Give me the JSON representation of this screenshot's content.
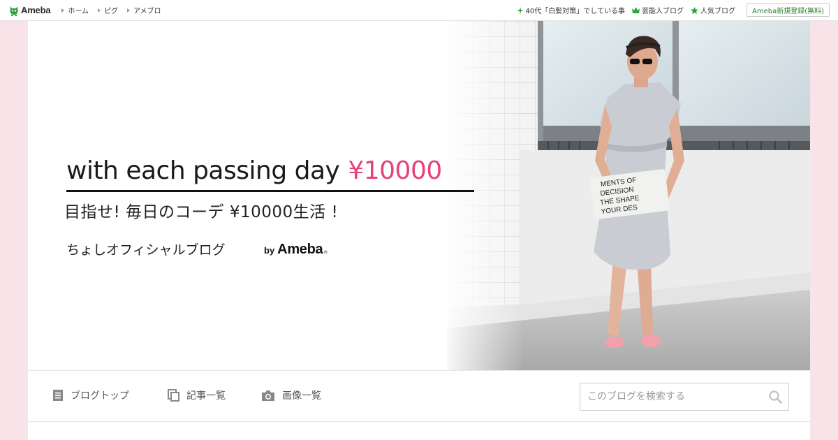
{
  "topbar": {
    "logo_text": "Ameba",
    "nav": [
      {
        "label": "ホーム"
      },
      {
        "label": "ピグ"
      },
      {
        "label": "アメブロ"
      }
    ],
    "right_links": [
      {
        "label": "40代「白髪対策」でしている事",
        "icon": "sparkle-icon"
      },
      {
        "label": "芸能人ブログ",
        "icon": "crown-icon"
      },
      {
        "label": "人気ブログ",
        "icon": "star-icon"
      }
    ],
    "signup_label": "Ameba新規登録(無料)"
  },
  "header": {
    "title_main": "with each passing day",
    "title_price": "¥10000",
    "subtitle": "目指せ! 毎日のコーデ ¥10000生活 !",
    "blog_name": "ちょしオフィシャルブログ",
    "by_label": "by",
    "by_brand": "Ameba",
    "reg_mark": "®",
    "photo_text": [
      "MENTS OF",
      "DECISION",
      "THE SHAPE",
      "YOUR DES"
    ]
  },
  "nav": {
    "items": [
      {
        "label": "ブログトップ",
        "icon": "document-icon"
      },
      {
        "label": "記事一覧",
        "icon": "copy-icon"
      },
      {
        "label": "画像一覧",
        "icon": "camera-icon"
      }
    ]
  },
  "search": {
    "placeholder": "このブログを検索する",
    "icon": "search-icon"
  },
  "colors": {
    "accent_pink": "#e5427d",
    "brand_green": "#2d7c2d",
    "page_bg": "#f8e3e8"
  }
}
